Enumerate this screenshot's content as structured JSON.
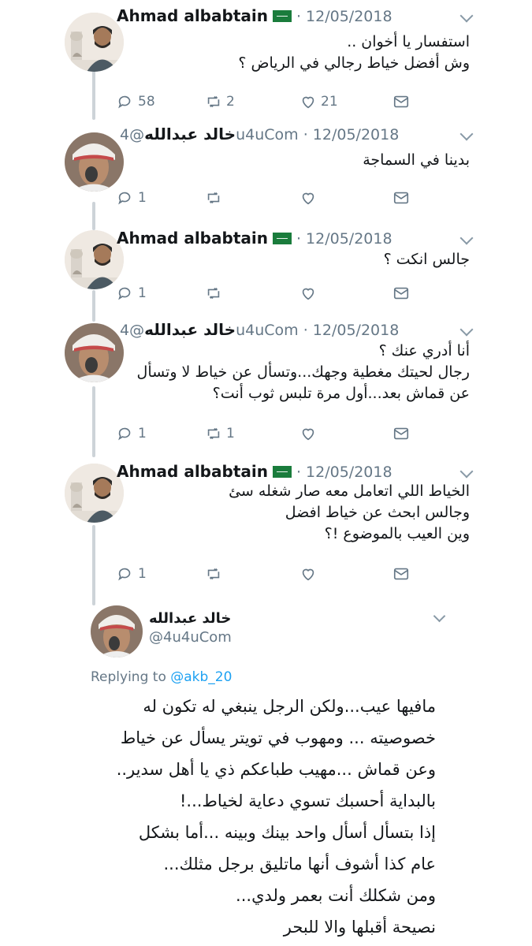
{
  "thread": {
    "tweets": [
      {
        "author": "Ahmad albabtain",
        "handle": "",
        "date": "· 12/05/2018",
        "lines": [
          "استفسار يا أخوان ..",
          "وش أفضل خياط رجالي في الرياض ؟"
        ],
        "replies": "58",
        "retweets": "2",
        "likes": "21",
        "avatar": "avatar-ahmad"
      },
      {
        "author": "خالد عبدالله",
        "handle": "@4u4uCom",
        "date": "· 12/05/2018",
        "lines": [
          "بدينا في السماجة"
        ],
        "replies": "1",
        "retweets": "",
        "likes": "",
        "avatar": "avatar-khaled"
      },
      {
        "author": "Ahmad albabtain",
        "handle": "",
        "date": "· 12/05/2018",
        "lines": [
          "جالس انكت ؟"
        ],
        "replies": "1",
        "retweets": "",
        "likes": "",
        "avatar": "avatar-ahmad"
      },
      {
        "author": "خالد عبدالله",
        "handle": "@4u4uCom",
        "date": "· 12/05/2018",
        "lines": [
          "أنا أدري عنك ؟",
          "رجال لحيتك مغطية وجهك...وتسأل عن خياط لا وتسأل",
          "عن قماش بعد...أول مرة تلبس ثوب أنت؟"
        ],
        "replies": "1",
        "retweets": "1",
        "likes": "",
        "avatar": "avatar-khaled"
      },
      {
        "author": "Ahmad albabtain",
        "handle": "",
        "date": "· 12/05/2018",
        "lines": [
          "الخياط اللي اتعامل معه صار شغله سئ",
          "وجالس ابحث عن خياط افضل",
          "وين العيب بالموضوع !؟"
        ],
        "replies": "1",
        "retweets": "",
        "likes": "",
        "avatar": "avatar-ahmad"
      }
    ]
  },
  "card": {
    "author": "خالد عبدالله",
    "handle": "@4u4uCom",
    "replying_prefix": "Replying to ",
    "replying_to": "@akb_20",
    "lines": [
      "مافيها عيب...ولكن الرجل ينبغي له تكون له",
      "خصوصيته ... ومهوب في تويتر يسأل عن خياط",
      "وعن قماش ...مهيب طباعكم ذي يا أهل سدير..",
      "بالبداية أحسبك تسوي دعاية لخياط...!",
      "إذا بتسأل أسأل واحد بينك وبينه ...أما بشكل",
      "عام كذا أشوف أنها ماتليق برجل مثلك...",
      "ومن شكلك أنت بعمر ولدي...",
      "نصيحة أقبلها والا للبحر"
    ]
  },
  "colors": {
    "text": "#14171a",
    "muted": "#657786",
    "link": "#1da1f2",
    "line": "#cdd3d8"
  },
  "icons": [
    "reply-icon",
    "retweet-icon",
    "like-icon",
    "dm-icon",
    "chevron-down-icon",
    "saudi-flag-icon"
  ]
}
